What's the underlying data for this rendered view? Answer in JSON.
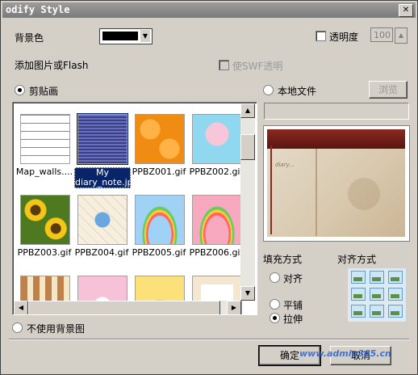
{
  "window": {
    "title": "odify Style"
  },
  "bg_color": {
    "label": "背景色",
    "swatch": "#000000"
  },
  "transparency": {
    "label": "透明度",
    "value": "100",
    "checked": false
  },
  "add_media": {
    "label": "添加图片或Flash"
  },
  "swf_transparent": {
    "label": "使SWF透明"
  },
  "clipart": {
    "label": "剪贴画",
    "selected": true
  },
  "local_file": {
    "label": "本地文件",
    "selected": false,
    "browse": "浏览"
  },
  "thumbnails": [
    {
      "name": "Map_walls....",
      "pattern": "bricks"
    },
    {
      "name": "My diary_note.jpg",
      "pattern": "stripes",
      "selected": true
    },
    {
      "name": "PPBZ001.gif",
      "pattern": "orange"
    },
    {
      "name": "PPBZ002.gif",
      "pattern": "girl"
    },
    {
      "name": "PPBZ003.gif",
      "pattern": "sunflower"
    },
    {
      "name": "PPBZ004.gif",
      "pattern": "tiles"
    },
    {
      "name": "PPBZ005.gif",
      "pattern": "rainbow-blue"
    },
    {
      "name": "PPBZ006.gif",
      "pattern": "rainbow-pink"
    },
    {
      "name": "",
      "pattern": "squares"
    },
    {
      "name": "",
      "pattern": "pink"
    },
    {
      "name": "",
      "pattern": "sun"
    },
    {
      "name": "",
      "pattern": "book"
    }
  ],
  "fill_mode": {
    "label": "填充方式",
    "options": [
      "对齐",
      "平铺",
      "拉伸"
    ],
    "selected": "拉伸"
  },
  "align_mode": {
    "label": "对齐方式"
  },
  "no_background": {
    "label": "不使用背景图"
  },
  "ok_button": "确定",
  "cancel_button": "取消",
  "watermark": "www.admin365.cn",
  "colors": {
    "selection": "#0a246a",
    "window_bg": "#d4d0c8"
  }
}
